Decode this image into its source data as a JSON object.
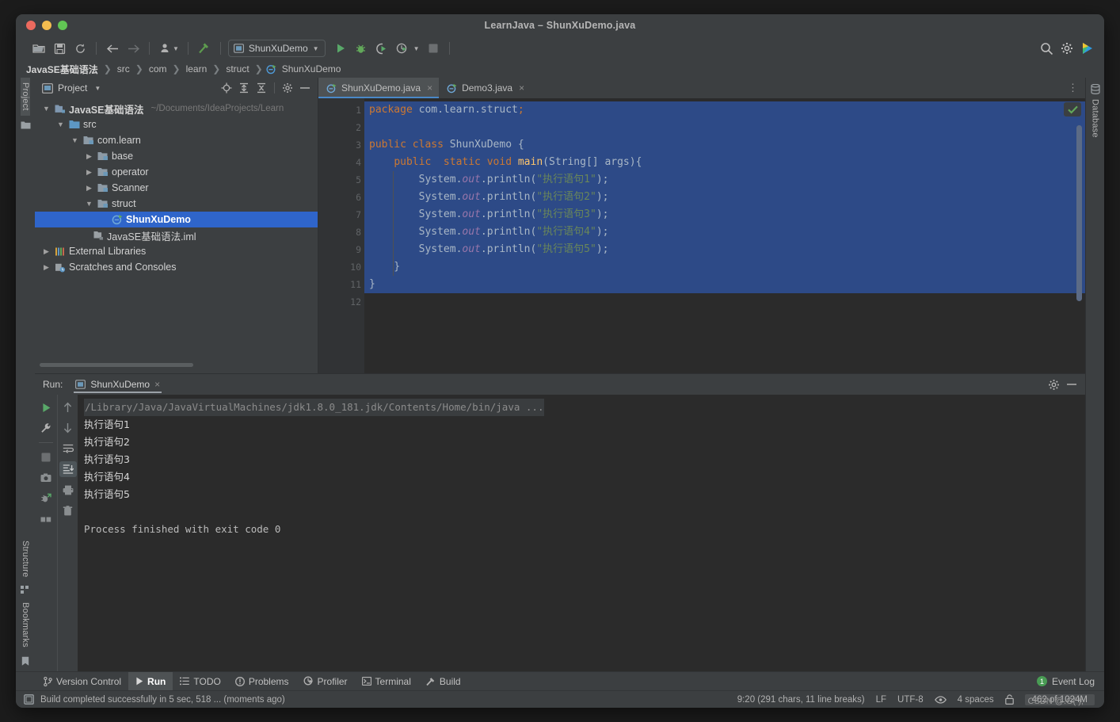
{
  "window": {
    "title": "LearnJava – ShunXuDemo.java",
    "traffic_lights": [
      "close",
      "minimize",
      "zoom"
    ]
  },
  "toolbar": {
    "icons": [
      "open-folder-icon",
      "save-icon",
      "sync-icon",
      "back-arrow-icon",
      "forward-arrow-icon",
      "profile-icon",
      "build-hammer-icon"
    ],
    "run_config": "ShunXuDemo",
    "run_label": "run-icon",
    "debug_label": "debug-icon",
    "coverage_label": "run-with-coverage-icon",
    "profile_label": "profiler-icon",
    "stop_label": "stop-icon",
    "right_icons": [
      "search-icon",
      "gear-icon",
      "ai-assistant-icon"
    ]
  },
  "breadcrumb": {
    "items": [
      "JavaSE基础语法",
      "src",
      "com",
      "learn",
      "struct",
      "ShunXuDemo"
    ],
    "separator": "›"
  },
  "left_strip": {
    "top": [
      "Project"
    ],
    "bottom": [
      "Structure",
      "Bookmarks"
    ]
  },
  "right_strip": {
    "items": [
      "Database"
    ]
  },
  "project_panel": {
    "title": "Project",
    "header_icons": [
      "locate-icon",
      "expand-all-icon",
      "collapse-all-icon",
      "settings-gear-icon",
      "hide-panel-icon"
    ],
    "tree": [
      {
        "indent": 0,
        "arrow": "v",
        "icon": "module-icon",
        "label": "JavaSE基础语法",
        "bold": true,
        "path": "~/Documents/IdeaProjects/Learn",
        "selected": false
      },
      {
        "indent": 1,
        "arrow": "v",
        "icon": "source-folder-icon",
        "label": "src",
        "bold": false,
        "path": "",
        "selected": false
      },
      {
        "indent": 2,
        "arrow": "v",
        "icon": "package-icon",
        "label": "com.learn",
        "bold": false,
        "path": "",
        "selected": false
      },
      {
        "indent": 3,
        "arrow": ">",
        "icon": "package-icon",
        "label": "base",
        "bold": false,
        "path": "",
        "selected": false
      },
      {
        "indent": 3,
        "arrow": ">",
        "icon": "package-icon",
        "label": "operator",
        "bold": false,
        "path": "",
        "selected": false
      },
      {
        "indent": 3,
        "arrow": ">",
        "icon": "package-icon",
        "label": "Scanner",
        "bold": false,
        "path": "",
        "selected": false
      },
      {
        "indent": 3,
        "arrow": "v",
        "icon": "package-icon",
        "label": "struct",
        "bold": false,
        "path": "",
        "selected": false
      },
      {
        "indent": 4,
        "arrow": "",
        "icon": "java-class-runnable-icon",
        "label": "ShunXuDemo",
        "bold": true,
        "path": "",
        "selected": true
      },
      {
        "indent": 2,
        "arrow": "",
        "icon": "iml-file-icon",
        "label": "JavaSE基础语法.iml",
        "bold": false,
        "path": "",
        "selected": false
      },
      {
        "indent": 0,
        "arrow": ">",
        "icon": "libraries-icon",
        "label": "External Libraries",
        "bold": false,
        "path": "",
        "selected": false
      },
      {
        "indent": 0,
        "arrow": ">",
        "icon": "scratches-icon",
        "label": "Scratches and Consoles",
        "bold": false,
        "path": "",
        "selected": false
      }
    ]
  },
  "editor": {
    "tabs": [
      {
        "label": "ShunXuDemo.java",
        "icon": "java-class-runnable-icon",
        "active": true,
        "close": "×"
      },
      {
        "label": "Demo3.java",
        "icon": "java-class-runnable-icon",
        "active": false,
        "close": "×"
      }
    ],
    "overflow_icon": "more-options-icon",
    "inspection_status": "no-problems-check-icon",
    "line_numbers": [
      "1",
      "2",
      "3",
      "4",
      "5",
      "6",
      "7",
      "8",
      "9",
      "10",
      "11",
      "12"
    ],
    "gutter_marks": {
      "3": "run-gutter-icon",
      "4": "run-gutter-icon",
      "9": "intention-bulb-icon"
    },
    "fold_marks": {
      "4": "fold-collapse-icon",
      "10": "fold-collapse-icon"
    },
    "lines": [
      "package com.learn.struct;",
      "",
      "public class ShunXuDemo {",
      "    public  static void main(String[] args){",
      "        System.out.println(\"执行语句1\");",
      "        System.out.println(\"执行语句2\");",
      "        System.out.println(\"执行语句3\");",
      "        System.out.println(\"执行语句4\");",
      "        System.out.println(\"执行语句5\");",
      "    }",
      "}",
      ""
    ],
    "selection_active": true
  },
  "run_panel": {
    "label": "Run:",
    "tab": "ShunXuDemo",
    "tab_icon": "run-config-icon",
    "tab_close": "×",
    "header_icons": [
      "settings-gear-icon",
      "hide-panel-icon"
    ],
    "left_icons": [
      "rerun-icon",
      "wrench-settings-icon",
      "stop-icon",
      "camera-snapshot-icon",
      "debug-rerun-icon",
      "layout-icon"
    ],
    "right_icons": [
      "scroll-up-icon",
      "scroll-down-icon",
      "soft-wrap-icon",
      "scroll-to-end-icon",
      "print-icon",
      "trash-icon"
    ],
    "console": {
      "command": "/Library/Java/JavaVirtualMachines/jdk1.8.0_181.jdk/Contents/Home/bin/java ...",
      "output": [
        "执行语句1",
        "执行语句2",
        "执行语句3",
        "执行语句4",
        "执行语句5",
        "",
        "Process finished with exit code 0"
      ]
    }
  },
  "bottom_bar": {
    "items": [
      {
        "label": "Version Control",
        "icon": "branch-icon",
        "active": false
      },
      {
        "label": "Run",
        "icon": "run-icon",
        "active": true
      },
      {
        "label": "TODO",
        "icon": "todo-list-icon",
        "active": false
      },
      {
        "label": "Problems",
        "icon": "problems-icon",
        "active": false
      },
      {
        "label": "Profiler",
        "icon": "profiler-icon",
        "active": false
      },
      {
        "label": "Terminal",
        "icon": "terminal-icon",
        "active": false
      },
      {
        "label": "Build",
        "icon": "build-hammer-icon",
        "active": false
      }
    ],
    "event_log": {
      "count": "1",
      "label": "Event Log"
    }
  },
  "status_bar": {
    "build_icon": "build-status-icon",
    "message": "Build completed successfully in 5 sec, 518 ... (moments ago)",
    "caret": "9:20 (291 chars, 11 line breaks)",
    "line_separator": "LF",
    "encoding": "UTF-8",
    "reader_mode_icon": "eye-icon",
    "indent": "4 spaces",
    "lock_icon": "unlock-icon",
    "memory": "462 of 1024M"
  },
  "watermark": "CSDN @.G( );",
  "colors": {
    "accent_blue": "#2f65ca",
    "selection_blue": "#2d4a87",
    "panel_bg": "#3c3f41",
    "editor_bg": "#2b2b2b",
    "green": "#499c54",
    "string_green": "#6a8759",
    "keyword_orange": "#cc7832",
    "field_purple": "#9876aa",
    "method_yellow": "#ffc66d"
  }
}
